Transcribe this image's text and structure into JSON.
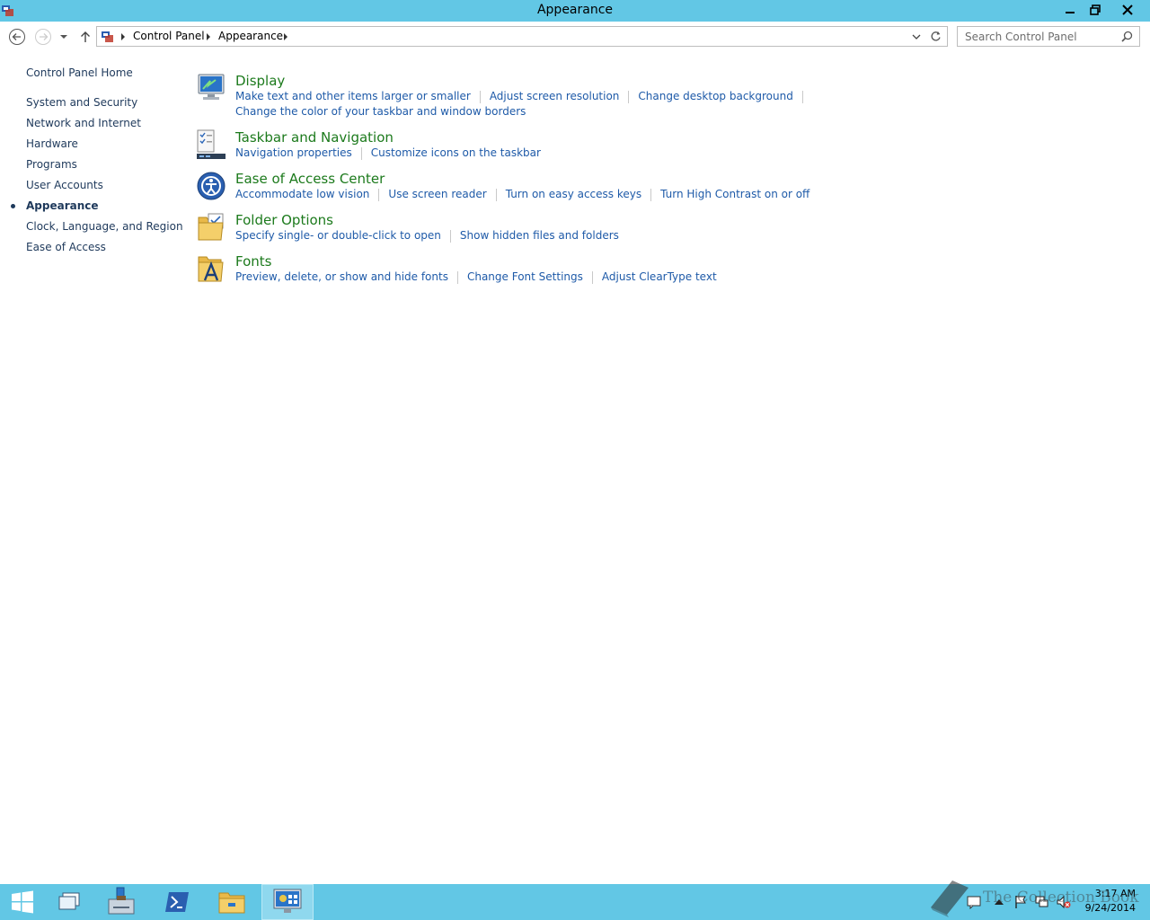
{
  "window": {
    "title": "Appearance"
  },
  "address": {
    "crumbs": [
      "Control Panel",
      "Appearance"
    ]
  },
  "search": {
    "placeholder": "Search Control Panel"
  },
  "sidebar": {
    "home": "Control Panel Home",
    "items": [
      {
        "label": "System and Security",
        "active": false
      },
      {
        "label": "Network and Internet",
        "active": false
      },
      {
        "label": "Hardware",
        "active": false
      },
      {
        "label": "Programs",
        "active": false
      },
      {
        "label": "User Accounts",
        "active": false
      },
      {
        "label": "Appearance",
        "active": true
      },
      {
        "label": "Clock, Language, and Region",
        "active": false
      },
      {
        "label": "Ease of Access",
        "active": false
      }
    ]
  },
  "categories": [
    {
      "title": "Display",
      "icon": "display-icon",
      "links": [
        "Make text and other items larger or smaller",
        "Adjust screen resolution",
        "Change desktop background",
        "Change the color of your taskbar and window borders"
      ]
    },
    {
      "title": "Taskbar and Navigation",
      "icon": "taskbar-icon",
      "links": [
        "Navigation properties",
        "Customize icons on the taskbar"
      ]
    },
    {
      "title": "Ease of Access Center",
      "icon": "ease-of-access-icon",
      "links": [
        "Accommodate low vision",
        "Use screen reader",
        "Turn on easy access keys",
        "Turn High Contrast on or off"
      ]
    },
    {
      "title": "Folder Options",
      "icon": "folder-options-icon",
      "links": [
        "Specify single- or double-click to open",
        "Show hidden files and folders"
      ]
    },
    {
      "title": "Fonts",
      "icon": "fonts-icon",
      "links": [
        "Preview, delete, or show and hide fonts",
        "Change Font Settings",
        "Adjust ClearType text"
      ]
    }
  ],
  "taskbar": {
    "time": "3:17 AM",
    "date": "9/24/2014"
  },
  "watermark": "The Collection Book",
  "colors": {
    "titlebar": "#62c7e5",
    "link": "#1e5aa8",
    "heading": "#1c7a1c"
  }
}
